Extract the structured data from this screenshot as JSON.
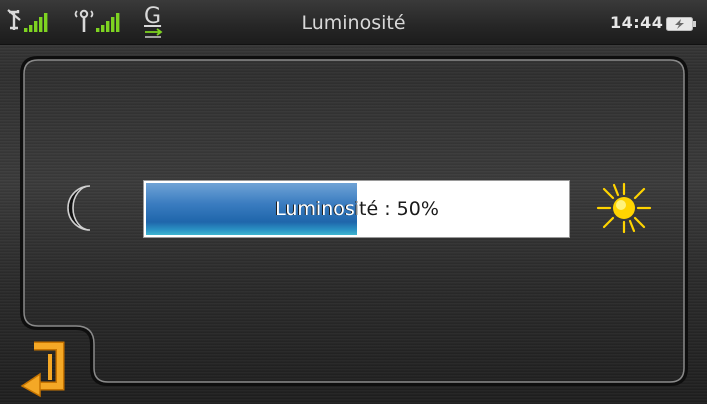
{
  "status_bar": {
    "title": "Luminosité",
    "clock": "14:44",
    "network_letter": "G",
    "icons": [
      "satellite-signal-icon",
      "antenna-signal-icon",
      "gprs-icon",
      "battery-charging-icon"
    ]
  },
  "brightness": {
    "label": "Luminosité : 50%",
    "level_percent": 50,
    "min_icon": "moon-icon",
    "max_icon": "sun-icon"
  },
  "back_button": {
    "icon": "back-arrow-icon"
  },
  "colors": {
    "accent_fill": "#1f66ab",
    "sun": "#ffd400",
    "back_icon": "#f0a020"
  }
}
